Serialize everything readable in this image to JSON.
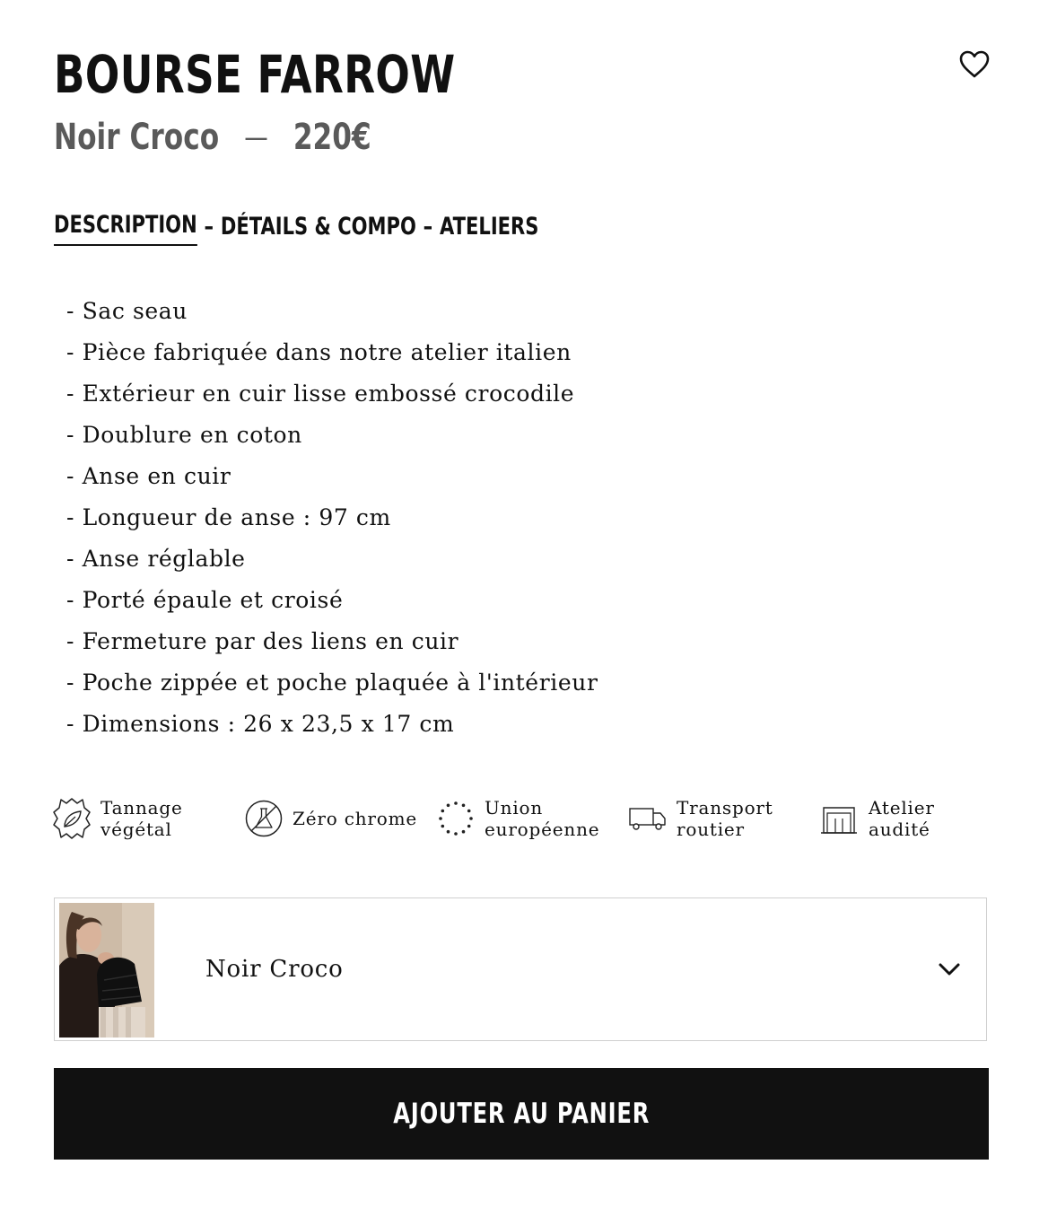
{
  "product": {
    "title": "BOURSE FARROW",
    "color": "Noir Croco",
    "separator": "—",
    "price": "220€"
  },
  "tabs": [
    {
      "label": "DESCRIPTION",
      "active": true
    },
    {
      "label": "DÉTAILS & COMPO",
      "active": false
    },
    {
      "label": "ATELIERS",
      "active": false
    }
  ],
  "tab_separator": "–",
  "description": [
    "- Sac seau",
    "- Pièce fabriquée dans notre atelier italien",
    "- Extérieur en cuir lisse embossé crocodile",
    "- Doublure en coton",
    "- Anse en cuir",
    "- Longueur de anse : 97 cm",
    "- Anse réglable",
    "- Porté épaule et croisé",
    "- Fermeture par des liens en cuir",
    "- Poche zippée et poche plaquée à l'intérieur",
    "- Dimensions : 26 x 23,5 x 17 cm"
  ],
  "features": [
    {
      "icon": "leather-leaf-icon",
      "line1": "Tannage",
      "line2": "végétal"
    },
    {
      "icon": "zero-chrome-icon",
      "line1": "Zéro chrome",
      "line2": ""
    },
    {
      "icon": "eu-stars-icon",
      "line1": "Union",
      "line2": "européenne"
    },
    {
      "icon": "truck-icon",
      "line1": "Transport",
      "line2": "routier"
    },
    {
      "icon": "factory-icon",
      "line1": "Atelier",
      "line2": "audité"
    }
  ],
  "variant": {
    "selected": "Noir Croco",
    "thumbnail_icon": "product-photo"
  },
  "cart_button": "AJOUTER AU PANIER",
  "colors": {
    "text": "#111111",
    "muted": "#5a5a5a",
    "button_bg": "#111111",
    "button_text": "#ffffff",
    "border": "#cfcfcf"
  }
}
